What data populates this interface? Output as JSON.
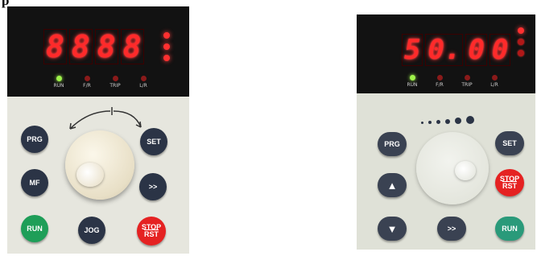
{
  "heading": "p",
  "panel_left": {
    "display": {
      "digits": [
        "8",
        "8",
        "8",
        "8"
      ]
    },
    "status_leds": [
      {
        "label": "RUN",
        "color": "green"
      },
      {
        "label": "F/R",
        "color": "red"
      },
      {
        "label": "TRIP",
        "color": "red"
      },
      {
        "label": "L/R",
        "color": "red"
      }
    ],
    "buttons": {
      "prg": "PRG",
      "set": "SET",
      "mf": "MF",
      "shift": ">>",
      "run": "RUN",
      "jog": "JOG",
      "stop_line1": "STOP",
      "stop_line2": "RST"
    },
    "colors": {
      "display_red": "#ff2a2a",
      "run_button": "#1e9e58",
      "stop_button": "#e52222",
      "key_navy": "#2b3446",
      "panel_face": "#e6e6de"
    }
  },
  "panel_right": {
    "display": {
      "digits": [
        "5",
        "0.",
        "0",
        "0"
      ]
    },
    "status_leds": [
      {
        "label": "RUN",
        "color": "green"
      },
      {
        "label": "F/R",
        "color": "red"
      },
      {
        "label": "TRIP",
        "color": "red"
      },
      {
        "label": "L/R",
        "color": "red"
      }
    ],
    "buttons": {
      "prg": "PRG",
      "set": "SET",
      "up": "▲",
      "down": "▼",
      "shift": ">>",
      "run": "RUN",
      "stop_line1": "STOP",
      "stop_line2": "RST"
    },
    "colors": {
      "display_red": "#ff2a2a",
      "run_button": "#2a9a7a",
      "stop_button": "#e52222",
      "key_navy": "#2b3446",
      "panel_face": "#dfe1d7"
    }
  }
}
